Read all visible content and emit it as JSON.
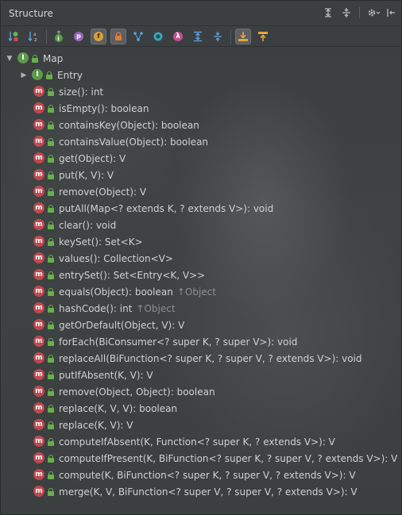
{
  "title": "Structure",
  "titlebar_icons": [
    "expand-all-icon",
    "collapse-all-icon",
    "gear-icon",
    "hide-panel-icon"
  ],
  "toolbar_buttons": [
    {
      "name": "sort-by-visibility-button",
      "glyph": "↓a",
      "active": false
    },
    {
      "name": "sort-alphabetically-button",
      "glyph": "↓z",
      "active": false
    },
    {
      "name": "show-inherited-button",
      "glyph": "i",
      "active": false
    },
    {
      "name": "show-properties-button",
      "glyph": "p",
      "active": false
    },
    {
      "name": "show-fields-button",
      "glyph": "f",
      "active": true
    },
    {
      "name": "show-non-public-button",
      "glyph": "🔒",
      "active": true
    },
    {
      "name": "show-anonymous-button",
      "glyph": "⑂",
      "active": false
    },
    {
      "name": "show-lambdas-button",
      "glyph": "●",
      "active": false
    },
    {
      "name": "show-annotations-button",
      "glyph": "λ",
      "active": false
    },
    {
      "name": "expand-all-button",
      "glyph": "⇕",
      "active": false
    },
    {
      "name": "collapse-all-button",
      "glyph": "⇳",
      "active": false
    },
    {
      "name": "autoscroll-to-source-button",
      "glyph": "⤓",
      "active": true
    },
    {
      "name": "autoscroll-from-source-button",
      "glyph": "⤒",
      "active": false
    }
  ],
  "colors": {
    "method_badge": "#c0484f",
    "interface_badge": "#5c9a4c",
    "public_lock": "#67b04b"
  },
  "tree": {
    "root": {
      "label": "Map",
      "kind": "interface",
      "expanded": true
    },
    "children": [
      {
        "label": "Entry",
        "kind": "interface",
        "expandable": true
      },
      {
        "label": "size(): int",
        "kind": "method"
      },
      {
        "label": "isEmpty(): boolean",
        "kind": "method"
      },
      {
        "label": "containsKey(Object): boolean",
        "kind": "method"
      },
      {
        "label": "containsValue(Object): boolean",
        "kind": "method"
      },
      {
        "label": "get(Object): V",
        "kind": "method"
      },
      {
        "label": "put(K, V): V",
        "kind": "method"
      },
      {
        "label": "remove(Object): V",
        "kind": "method"
      },
      {
        "label": "putAll(Map<? extends K, ? extends V>): void",
        "kind": "method"
      },
      {
        "label": "clear(): void",
        "kind": "method"
      },
      {
        "label": "keySet(): Set<K>",
        "kind": "method"
      },
      {
        "label": "values(): Collection<V>",
        "kind": "method"
      },
      {
        "label": "entrySet(): Set<Entry<K, V>>",
        "kind": "method"
      },
      {
        "label": "equals(Object): boolean",
        "kind": "method",
        "inherited": "↑Object"
      },
      {
        "label": "hashCode(): int",
        "kind": "method",
        "inherited": "↑Object"
      },
      {
        "label": "getOrDefault(Object, V): V",
        "kind": "method"
      },
      {
        "label": "forEach(BiConsumer<? super K, ? super V>): void",
        "kind": "method"
      },
      {
        "label": "replaceAll(BiFunction<? super K, ? super V, ? extends V>): void",
        "kind": "method"
      },
      {
        "label": "putIfAbsent(K, V): V",
        "kind": "method"
      },
      {
        "label": "remove(Object, Object): boolean",
        "kind": "method"
      },
      {
        "label": "replace(K, V, V): boolean",
        "kind": "method"
      },
      {
        "label": "replace(K, V): V",
        "kind": "method"
      },
      {
        "label": "computeIfAbsent(K, Function<? super K, ? extends V>): V",
        "kind": "method"
      },
      {
        "label": "computeIfPresent(K, BiFunction<? super K, ? super V, ? extends V>): V",
        "kind": "method"
      },
      {
        "label": "compute(K, BiFunction<? super K, ? super V, ? extends V>): V",
        "kind": "method"
      },
      {
        "label": "merge(K, V, BiFunction<? super V, ? super V, ? extends V>): V",
        "kind": "method"
      }
    ]
  }
}
